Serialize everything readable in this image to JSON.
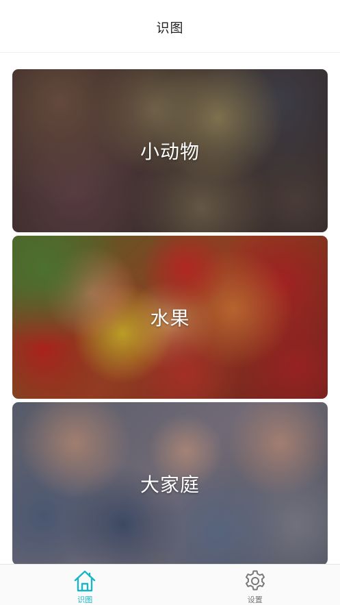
{
  "header": {
    "title": "识图"
  },
  "cards": [
    {
      "label": "小动物"
    },
    {
      "label": "水果"
    },
    {
      "label": "大家庭"
    }
  ],
  "tabbar": {
    "tabs": [
      {
        "label": "识图",
        "icon": "home-icon",
        "active": true
      },
      {
        "label": "设置",
        "icon": "gear-icon",
        "active": false
      }
    ]
  },
  "colors": {
    "accent": "#18b6c4",
    "inactive": "#777777"
  }
}
